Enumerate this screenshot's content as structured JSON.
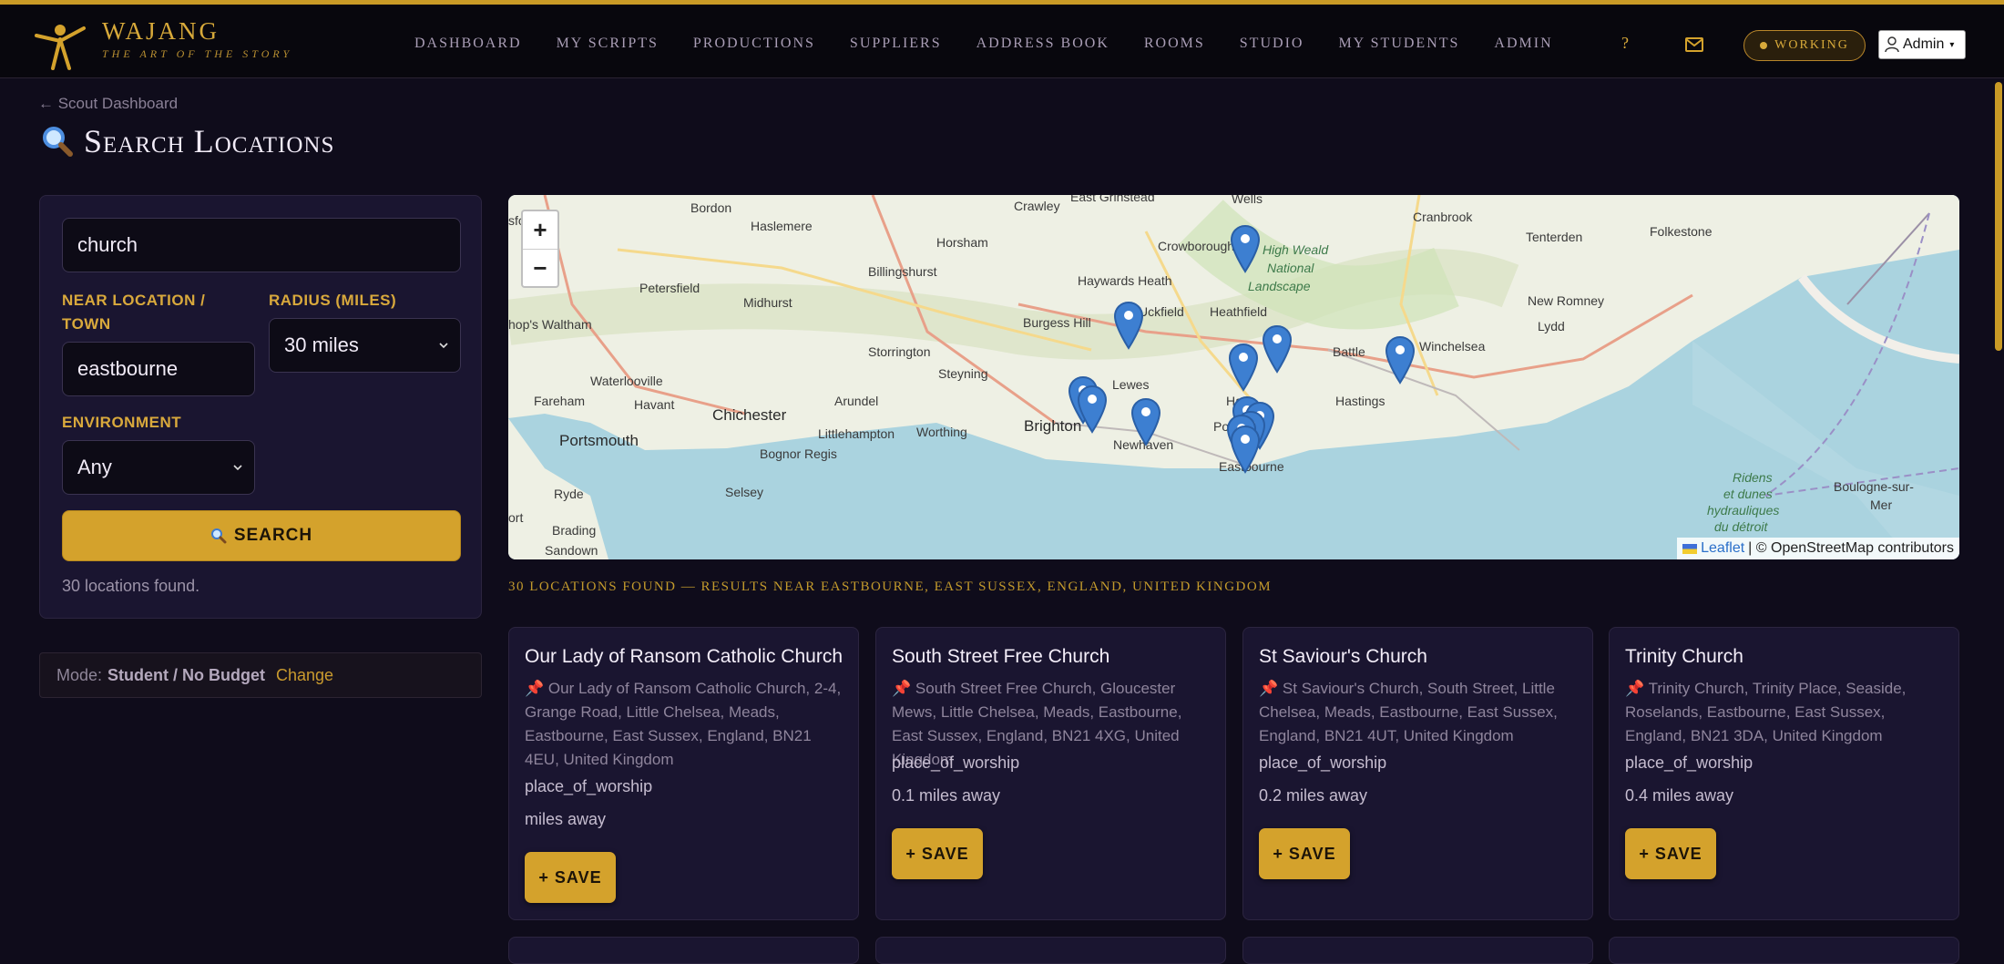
{
  "brand": {
    "name": "WAJANG",
    "tagline": "THE ART OF THE STORY"
  },
  "nav": [
    {
      "label": "DASHBOARD"
    },
    {
      "label": "MY SCRIPTS"
    },
    {
      "label": "PRODUCTIONS"
    },
    {
      "label": "SUPPLIERS"
    },
    {
      "label": "ADDRESS BOOK"
    },
    {
      "label": "ROOMS"
    },
    {
      "label": "STUDIO"
    },
    {
      "label": "MY STUDENTS"
    },
    {
      "label": "ADMIN"
    }
  ],
  "header": {
    "help": "?",
    "working": "WORKING",
    "admin": "Admin"
  },
  "page": {
    "back": "← Scout Dashboard",
    "title": "Search Locations"
  },
  "search": {
    "query": "church",
    "near_label": "NEAR LOCATION / TOWN",
    "near_value": "eastbourne",
    "radius_label": "RADIUS (MILES)",
    "radius_value": "30 miles",
    "env_label": "ENVIRONMENT",
    "env_value": "Any",
    "button": "SEARCH",
    "found": "30 locations found."
  },
  "mode": {
    "prefix": "Mode:",
    "value": "Student / No Budget",
    "change": "Change"
  },
  "map": {
    "zoom_in": "+",
    "zoom_out": "−",
    "attribution_leaflet": "Leaflet",
    "attribution_osm": "| © OpenStreetMap contributors",
    "places": {
      "bordon": "Bordon",
      "haslemere": "Haslemere",
      "crawley": "Crawley",
      "east_grinstead": "East Grinstead",
      "wells": "Wells",
      "cranbrook": "Cranbrook",
      "tenterden": "Tenterden",
      "folkestone": "Folkestone",
      "sford": "sford",
      "horsham": "Horsham",
      "crowborough": "Crowborough",
      "billingshurst": "Billingshurst",
      "haywards_heath": "Haywards Heath",
      "petersfield": "Petersfield",
      "midhurst": "Midhurst",
      "uckfield": "Uckfield",
      "heathfield": "Heathfield",
      "high_weald_1": "High Weald",
      "high_weald_2": "National",
      "high_weald_3": "Landscape",
      "new_romney": "New Romney",
      "lydd": "Lydd",
      "hops_waltham": "hop's Waltham",
      "burgess_hill": "Burgess Hill",
      "storrington": "Storrington",
      "battle": "Battle",
      "winchelsea": "Winchelsea",
      "steyning": "Steyning",
      "lewes": "Lewes",
      "waterlooville": "Waterlooville",
      "fareham": "Fareham",
      "havant": "Havant",
      "chichester": "Chichester",
      "arundel": "Arundel",
      "hailsham": "Ha",
      "hastings": "Hastings",
      "portsmouth": "Portsmouth",
      "littlehampton": "Littlehampton",
      "worthing": "Worthing",
      "brighton": "Brighton",
      "newhaven": "Newhaven",
      "polegate": "Po",
      "bognor": "Bognor Regis",
      "eastbourne": "Eastbourne",
      "ryde": "Ryde",
      "selsey": "Selsey",
      "ort": "ort",
      "brading": "Brading",
      "sandown": "Sandown",
      "boulogne_1": "Boulogne-sur-",
      "boulogne_2": "Mer",
      "ridens_1": "Ridens",
      "ridens_2": "et dunes",
      "ridens_3": "hydrauliques",
      "ridens_4": "du détroit"
    }
  },
  "results": {
    "heading": "30 LOCATIONS FOUND — RESULTS NEAR EASTBOURNE, EAST SUSSEX, ENGLAND, UNITED KINGDOM",
    "save_label": "+ SAVE",
    "items": [
      {
        "name": "Our Lady of Ransom Catholic Church",
        "address": "Our Lady of Ransom Catholic Church, 2-4, Grange Road, Little Chelsea, Meads, Eastbourne, East Sussex, England, BN21 4EU, United Kingdom",
        "type": "place_of_worship",
        "distance": "miles away"
      },
      {
        "name": "South Street Free Church",
        "address": "South Street Free Church, Gloucester Mews, Little Chelsea, Meads, Eastbourne, East Sussex, England, BN21 4XG, United Kingdom",
        "type": "place_of_worship",
        "distance": "0.1 miles away"
      },
      {
        "name": "St Saviour's Church",
        "address": "St Saviour's Church, South Street, Little Chelsea, Meads, Eastbourne, East Sussex, England, BN21 4UT, United Kingdom",
        "type": "place_of_worship",
        "distance": "0.2 miles away"
      },
      {
        "name": "Trinity Church",
        "address": "Trinity Church, Trinity Place, Seaside, Roselands, Eastbourne, East Sussex, England, BN21 3DA, United Kingdom",
        "type": "place_of_worship",
        "distance": "0.4 miles away"
      }
    ]
  },
  "colors": {
    "accent": "#d4a22c",
    "background": "#0f0c1b",
    "panel": "#1a1530",
    "pin": "#3d7fd1"
  }
}
